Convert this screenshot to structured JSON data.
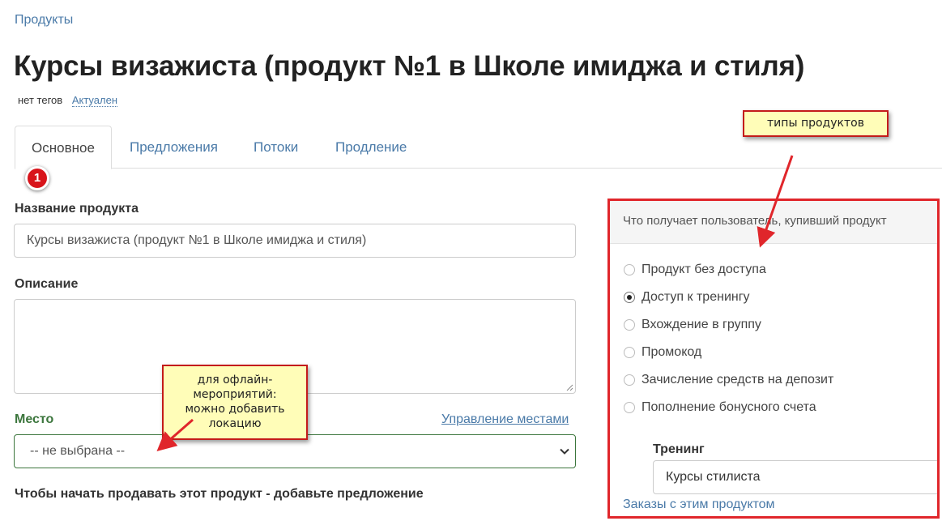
{
  "breadcrumb": "Продукты",
  "page_title": "Курсы визажиста (продукт №1 в Школе имиджа и стиля)",
  "meta": {
    "tags": "нет тегов",
    "status": "Актуален"
  },
  "tabs": [
    {
      "label": "Основное",
      "active": true
    },
    {
      "label": "Предложения",
      "active": false
    },
    {
      "label": "Потоки",
      "active": false
    },
    {
      "label": "Продление",
      "active": false
    }
  ],
  "step_badge": "1",
  "form": {
    "name_label": "Название продукта",
    "name_value": "Курсы визажиста (продукт №1 в Школе имиджа и стиля)",
    "description_label": "Описание",
    "description_value": "",
    "place_label": "Место",
    "manage_places_link": "Управление местами",
    "place_select_value": "-- не выбрана --",
    "start_selling_note": "Чтобы начать продавать этот продукт - добавьте предложение"
  },
  "product_panel": {
    "heading": "Что получает пользователь, купивший продукт",
    "options": [
      {
        "label": "Продукт без доступа",
        "checked": false
      },
      {
        "label": "Доступ к тренингу",
        "checked": true
      },
      {
        "label": "Вхождение в группу",
        "checked": false
      },
      {
        "label": "Промокод",
        "checked": false
      },
      {
        "label": "Зачисление средств на депозит",
        "checked": false
      },
      {
        "label": "Пополнение бонусного счета",
        "checked": false
      }
    ],
    "training_label": "Тренинг",
    "training_value": "Курсы стилиста",
    "orders_link": "Заказы с этим продуктом"
  },
  "annotations": {
    "product_types": "типы продуктов",
    "offline_line1": "для офлайн-",
    "offline_line2": "мероприятий:",
    "offline_line3": "можно добавить",
    "offline_line4": "локацию"
  },
  "colors": {
    "link": "#4a7aa8",
    "highlight_border": "#e0262b",
    "callout_bg": "#fffdb8",
    "valid_green": "#3c763d",
    "badge_red": "#d8141b"
  }
}
